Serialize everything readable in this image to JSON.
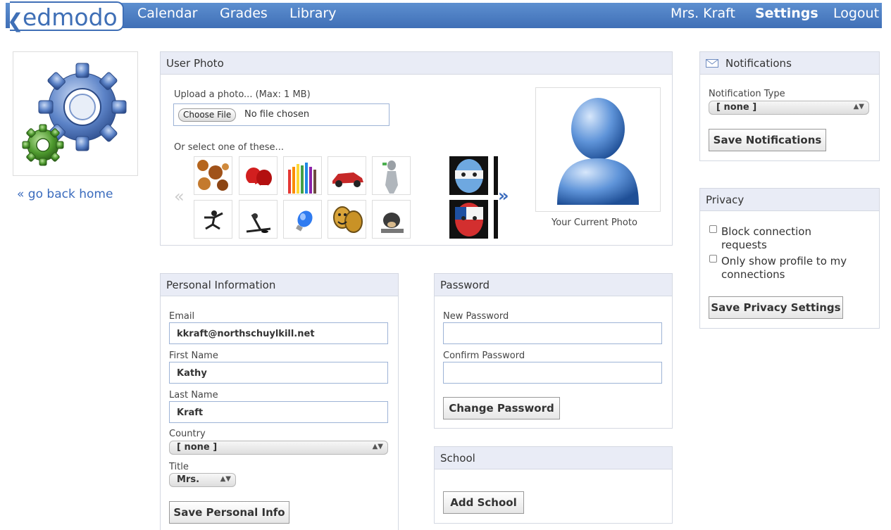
{
  "header": {
    "logo_text": "edmodo",
    "nav_calendar": "Calendar",
    "nav_grades": "Grades",
    "nav_library": "Library",
    "user_name": "Mrs. Kraft",
    "settings": "Settings",
    "logout": "Logout"
  },
  "sidebar": {
    "back_link": "« go back home"
  },
  "user_photo": {
    "title": "User Photo",
    "upload_label": "Upload a photo... (Max: 1 MB)",
    "choose_file": "Choose File",
    "no_file": "No file chosen",
    "select_label": "Or select one of these...",
    "prev_arrow": "«",
    "next_arrow": "»",
    "current_caption": "Your Current Photo"
  },
  "personal": {
    "title": "Personal Information",
    "email_label": "Email",
    "email_value": "kkraft@northschuylkill.net",
    "first_label": "First Name",
    "first_value": "Kathy",
    "last_label": "Last Name",
    "last_value": "Kraft",
    "country_label": "Country",
    "country_value": "[ none ]",
    "title_label": "Title",
    "title_value": "Mrs.",
    "save_button": "Save Personal Info"
  },
  "password": {
    "title": "Password",
    "new_label": "New Password",
    "confirm_label": "Confirm Password",
    "change_button": "Change Password"
  },
  "school": {
    "title": "School",
    "add_button": "Add School"
  },
  "notifications": {
    "title": "Notifications",
    "type_label": "Notification Type",
    "type_value": "[ none ]",
    "save_button": "Save Notifications"
  },
  "privacy": {
    "title": "Privacy",
    "block_label_1": "Block connection",
    "block_label_2": "requests",
    "only_label_1": "Only show profile to my",
    "only_label_2": "connections",
    "save_button": "Save Privacy Settings"
  },
  "colors": {
    "brand_blue": "#3f6fb6",
    "panel_header": "#e9ecf6",
    "link_blue": "#3a6bbd"
  }
}
